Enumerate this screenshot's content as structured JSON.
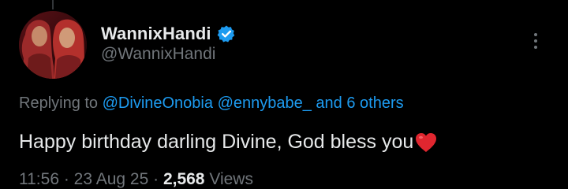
{
  "author": {
    "name": "WannixHandi",
    "handle": "@WannixHandi",
    "verified_icon": "verified-badge-icon",
    "verified_color": "#1d9bf0"
  },
  "replying": {
    "prefix": "Replying to ",
    "mentions": [
      "@DivineOnobia",
      "@ennybabe_"
    ],
    "others": "and 6 others"
  },
  "tweet": {
    "text": "Happy birthday darling Divine, God bless you",
    "emoji": "red-heart-icon"
  },
  "meta": {
    "time": "11:56",
    "separator": " · ",
    "date": "23 Aug 25",
    "views_count": "2,568",
    "views_label": " Views"
  },
  "colors": {
    "background": "#000000",
    "text_primary": "#e7e9ea",
    "text_secondary": "#71767b",
    "link": "#1d9bf0"
  }
}
